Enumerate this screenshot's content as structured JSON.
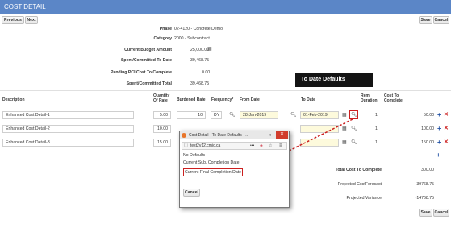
{
  "title": "COST DETAIL",
  "toolbar": {
    "previous": "Previous",
    "next": "Next",
    "save": "Save",
    "cancel": "Cancel"
  },
  "summary": {
    "phase_label": "Phase",
    "phase_value": "02-4120 - Concrete Demo",
    "category_label": "Category",
    "category_value": "2000 - Subcontract",
    "budget_label": "Current Budget Amount",
    "budget_value": "25,000.00",
    "spent_label": "Spent/Committed To Date",
    "spent_value": "39,468.75",
    "pending_label": "Pending PCI Cost To Complete",
    "pending_value": "0.00",
    "total_label": "Spent/Committed Total",
    "total_value": "39,468.75"
  },
  "columns": {
    "description": "Description",
    "quantity": "Quantity Of Rate",
    "burdened": "Burdened Rate",
    "frequency": "Frequency*",
    "from_date": "From Date",
    "to_date": "To Date",
    "rem_duration": "Rem. Duration",
    "cost_to_complete": "Cost To Complete"
  },
  "rows": [
    {
      "description": "Enhanced Cost Detail-1",
      "quantity": "5.00",
      "burdened": "10",
      "frequency": "DY",
      "from_date": "28-Jan-2019",
      "to_date": "01-Feb-2019",
      "rem_duration": "1",
      "cost": "50.00"
    },
    {
      "description": "Enhanced Cost Detail-2",
      "quantity": "10.00",
      "burdened": "",
      "frequency": "",
      "from_date": "",
      "to_date": "",
      "rem_duration": "1",
      "cost": "100.00"
    },
    {
      "description": "Enhanced Cost Detail-3",
      "quantity": "15.00",
      "burdened": "",
      "frequency": "",
      "from_date": "",
      "to_date": "",
      "rem_duration": "1",
      "cost": "150.00"
    }
  ],
  "totals": {
    "total_cost_label": "Total Cost To Complete",
    "total_cost_value": "300.00",
    "forecast_label": "Projected CostForecast",
    "forecast_value": "39768.75",
    "variance_label": "Projected Variance",
    "variance_value": "-14768.75"
  },
  "callout": "To Date Defaults",
  "popup": {
    "title": "Cost Detail - To Date Defaults - ...",
    "url": "test2v12.cmic.ca",
    "options": [
      "No Defaults",
      "Current Sub. Completion Date",
      "Current Final Completion Date"
    ],
    "cancel": "Cancel"
  },
  "colors": {
    "header": "#5b86c7",
    "highlight": "#cc1f1f",
    "field_yellow": "#fdfadc"
  },
  "icons": [
    "calendar-icon",
    "search-icon",
    "plus-icon",
    "delete-icon",
    "firefox-icon"
  ]
}
